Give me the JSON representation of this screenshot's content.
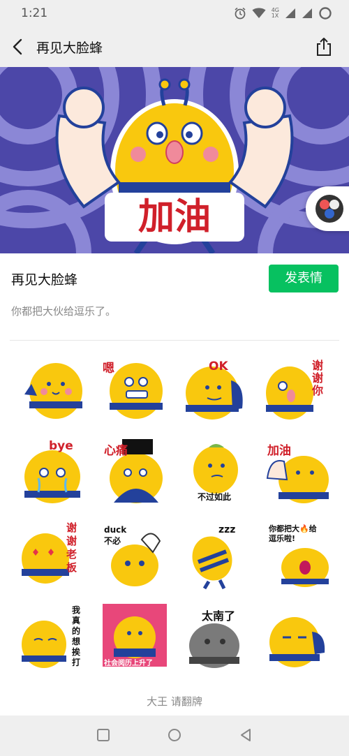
{
  "status_bar": {
    "time": "1:21",
    "network": "4G",
    "network_sub": "1X",
    "icons": [
      "alarm-icon",
      "wifi-icon",
      "signal-icon",
      "signal-icon-2",
      "battery-icon"
    ]
  },
  "nav": {
    "title": "再见大脸蜂",
    "back_icon": "chevron-left-icon",
    "share_icon": "share-icon"
  },
  "banner": {
    "caption": "加油",
    "float_icon": "sticker-pack-icon"
  },
  "pack": {
    "title": "再见大脸蜂",
    "send_label": "发表情",
    "description": "你都把大伙给逗乐了。"
  },
  "stickers": [
    {
      "caption": ""
    },
    {
      "caption": "嗯"
    },
    {
      "caption": "OK"
    },
    {
      "caption": "谢\n谢\n你"
    },
    {
      "caption": "bye"
    },
    {
      "caption": "心痛"
    },
    {
      "caption": "不过如此"
    },
    {
      "caption": "加油"
    },
    {
      "caption": "谢\n谢\n老\n板"
    },
    {
      "caption": "duck\n不必"
    },
    {
      "caption": "zzz"
    },
    {
      "caption": "你都把大🔥给\n逗乐啦!"
    },
    {
      "caption": "我\n真\n的\n想\n挨\n打"
    },
    {
      "caption": "社会阅历上升了"
    },
    {
      "caption": "太南了"
    },
    {
      "caption": ""
    }
  ],
  "footer": {
    "text": "大王 请翻牌"
  },
  "colors": {
    "accent": "#07c160",
    "bee_yellow": "#f9c80e",
    "bee_blue": "#23419b",
    "banner_purple": "#4c47a8",
    "banner_ring": "#8b87d6"
  }
}
